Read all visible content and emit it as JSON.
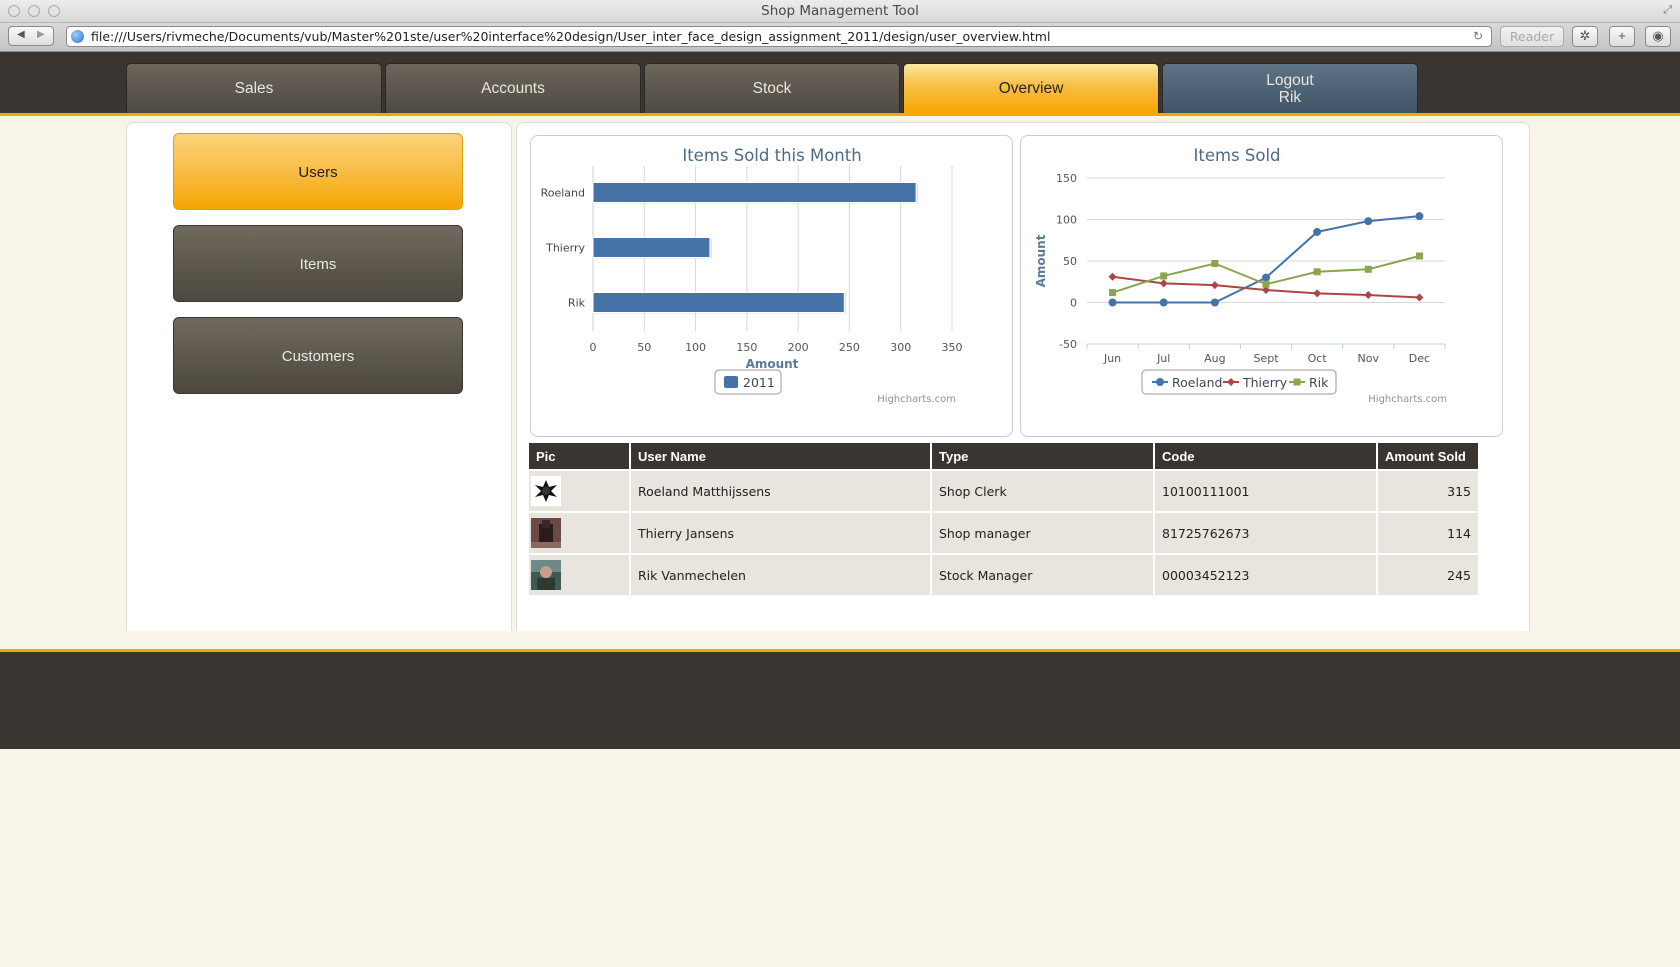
{
  "browser": {
    "window_title": "Shop Management Tool",
    "url": "file:///Users/rivmeche/Documents/vub/Master%201ste/user%20interface%20design/User_inter_face_design_assignment_2011/design/user_overview.html",
    "reader_label": "Reader"
  },
  "nav": {
    "tabs": [
      {
        "label": "Sales"
      },
      {
        "label": "Accounts"
      },
      {
        "label": "Stock"
      },
      {
        "label": "Overview"
      }
    ],
    "logout_label": "Logout",
    "logout_user": "Rik"
  },
  "sidebar": {
    "items": [
      {
        "label": "Users",
        "active": true
      },
      {
        "label": "Items",
        "active": false
      },
      {
        "label": "Customers",
        "active": false
      }
    ]
  },
  "chart_data": [
    {
      "type": "bar",
      "title": "Items Sold this Month",
      "xlabel": "Amount",
      "categories": [
        "Roeland",
        "Thierry",
        "Rik"
      ],
      "series": [
        {
          "name": "2011",
          "values": [
            315,
            114,
            245
          ],
          "color": "#4572a7"
        }
      ],
      "xlim": [
        0,
        350
      ],
      "ticks": [
        0,
        50,
        100,
        150,
        200,
        250,
        300,
        350
      ],
      "credit": "Highcharts.com",
      "legend": "bottom"
    },
    {
      "type": "line",
      "title": "Items Sold",
      "ylabel": "Amount",
      "categories": [
        "Jun",
        "Jul",
        "Aug",
        "Sept",
        "Oct",
        "Nov",
        "Dec"
      ],
      "ylim": [
        -50,
        150
      ],
      "ticks": [
        -50,
        0,
        50,
        100,
        150
      ],
      "series": [
        {
          "name": "Roeland",
          "values": [
            0,
            0,
            0,
            30,
            85,
            98,
            104
          ],
          "color": "#4572a7",
          "marker": "circle"
        },
        {
          "name": "Thierry",
          "values": [
            31,
            23,
            21,
            15,
            11,
            9,
            6
          ],
          "color": "#aa4643",
          "marker": "diamond"
        },
        {
          "name": "Rik",
          "values": [
            12,
            32,
            47,
            22,
            37,
            40,
            56
          ],
          "color": "#89a54e",
          "marker": "square"
        }
      ],
      "credit": "Highcharts.com",
      "legend": "bottom"
    }
  ],
  "table": {
    "headers": [
      "Pic",
      "User Name",
      "Type",
      "Code",
      "Amount Sold"
    ],
    "rows": [
      {
        "pic": "roeland-avatar",
        "name": "Roeland Matthijssens",
        "type": "Shop Clerk",
        "code": "10100111001",
        "amount": "315"
      },
      {
        "pic": "thierry-avatar",
        "name": "Thierry Jansens",
        "type": "Shop manager",
        "code": "81725762673",
        "amount": "114"
      },
      {
        "pic": "rik-avatar",
        "name": "Rik Vanmechelen",
        "type": "Stock Manager",
        "code": "00003452123",
        "amount": "245"
      }
    ]
  }
}
